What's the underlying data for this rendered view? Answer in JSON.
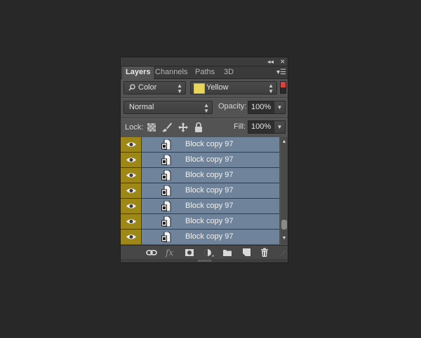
{
  "tabs": [
    {
      "label": "Layers",
      "active": true
    },
    {
      "label": "Channels",
      "active": false
    },
    {
      "label": "Paths",
      "active": false
    },
    {
      "label": "3D",
      "active": false
    }
  ],
  "filter": {
    "kind_label": "Color",
    "color_label": "Yellow",
    "color_swatch": "#e8d65a",
    "toggle_color": "#d9433b"
  },
  "blend": {
    "mode": "Normal",
    "opacity_label": "Opacity:",
    "opacity_value": "100%"
  },
  "lock": {
    "label": "Lock:",
    "fill_label": "Fill:",
    "fill_value": "100%"
  },
  "layers": [
    {
      "name": "Block copy 97"
    },
    {
      "name": "Block copy 97"
    },
    {
      "name": "Block copy 97"
    },
    {
      "name": "Block copy 97"
    },
    {
      "name": "Block copy 97"
    },
    {
      "name": "Block copy 97"
    },
    {
      "name": "Block copy 97"
    }
  ],
  "colors": {
    "layer_selected_bg": "#6f849a",
    "eye_label_bg": "#9c8717",
    "panel_bg": "#535353",
    "app_bg": "#282828"
  },
  "footer_icons": [
    "link-icon",
    "fx-icon",
    "mask-icon",
    "adjustment-icon",
    "folder-icon",
    "new-layer-icon",
    "trash-icon"
  ]
}
